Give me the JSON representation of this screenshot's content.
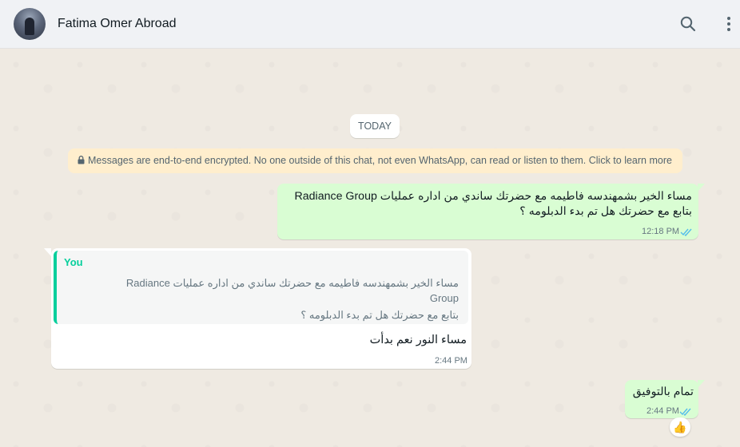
{
  "header": {
    "contact_name": "Fatima Omer Abroad",
    "search_icon": "search-icon",
    "menu_icon": "kebab-menu-icon"
  },
  "chat": {
    "date_divider": "TODAY",
    "encryption_notice": "Messages are end-to-end encrypted. No one outside of this chat, not even WhatsApp, can read or listen to them. Click to learn more",
    "messages": [
      {
        "direction": "outgoing",
        "lines": [
          "مساء الخير بشمهندسه فاطيمه مع حضرتك ساندي من اداره عمليات Radiance Group",
          "بتابع مع حضرتك هل تم بدء الدبلومه ؟"
        ],
        "time": "12:18 PM",
        "status": "read"
      },
      {
        "direction": "incoming",
        "quoted": {
          "author": "You",
          "lines": [
            "مساء الخير بشمهندسه فاطيمه مع حضرتك ساندي من اداره عمليات Radiance",
            "Group",
            "بتابع مع حضرتك هل تم بدء الدبلومه ؟"
          ]
        },
        "text": "مساء النور نعم بدأت",
        "time": "2:44 PM"
      },
      {
        "direction": "outgoing",
        "text": "تمام بالتوفيق",
        "time": "2:44 PM",
        "status": "read",
        "reaction": "👍"
      }
    ]
  },
  "colors": {
    "outgoing_bubble": "#d9fdd3",
    "incoming_bubble": "#ffffff",
    "read_ticks": "#53bdeb",
    "quote_accent": "#06cf9c",
    "encryption_bg": "#ffeecd"
  }
}
